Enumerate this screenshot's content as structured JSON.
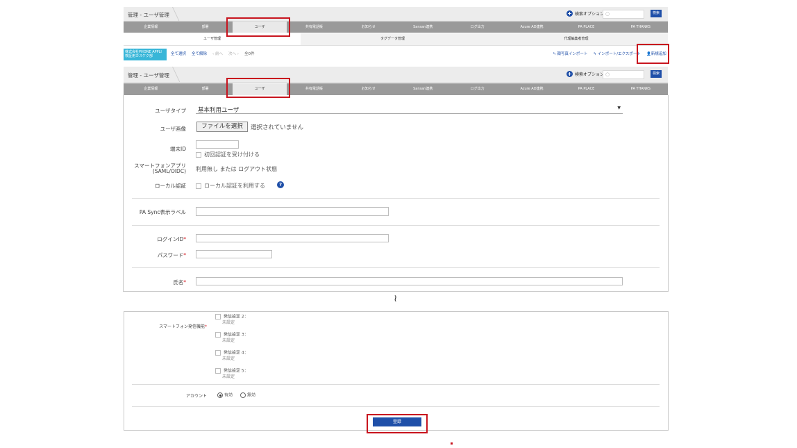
{
  "header": {
    "breadcrumb": "管理 - ユーザ管理",
    "search_option": "検索オプション",
    "search_button": "検索"
  },
  "nav": {
    "tabs": [
      "企業情報",
      "部署",
      "ユーザ",
      "共有電話帳",
      "お知らせ",
      "Sansan連携",
      "ログ出力",
      "Azure AD連携",
      "PA PLACE",
      "PA THANKS"
    ]
  },
  "subnav": {
    "tabs": [
      "ユーザ管理",
      "タグデータ管理",
      "代理編集者管理"
    ]
  },
  "toolbar": {
    "company": "株式会社PHONE APPLI 検証用カスケク部",
    "select_all": "全て選択",
    "deselect_all": "全て解除",
    "prev": "前へ",
    "next": "次へ",
    "page_info": "全0件",
    "import_bulk": "顔写真インポート",
    "import_export": "インポート/エクスポート",
    "add_new": "新規追加"
  },
  "form": {
    "user_type_label": "ユーザタイプ",
    "user_type_value": "基本利用ユーザ",
    "user_image_label": "ユーザ画像",
    "file_button": "ファイルを選択",
    "file_status": "選択されていません",
    "terminal_id_label": "端末ID",
    "first_auth_label": "初回認証を受け付ける",
    "smartphone_app_label_1": "スマートフォンアプリ",
    "smartphone_app_label_2": "(SAML/OIDC)",
    "smartphone_app_value": "利用無し または ログアウト状態",
    "local_auth_label": "ローカル認証",
    "local_auth_check": "ローカル認証を利用する",
    "help_icon": "?",
    "pa_sync_label": "PA Sync表示ラベル",
    "login_id_label": "ログインID",
    "password_label": "パスワード",
    "name_label": "氏名",
    "required_mark": "*"
  },
  "break_mark": "≀",
  "form2": {
    "smartphone_call_label": "スマートフォン発信機能",
    "required_mark": "*",
    "call_settings": [
      {
        "label": "発信設定 2：",
        "value": "未設定"
      },
      {
        "label": "発信設定 3：",
        "value": "未設定"
      },
      {
        "label": "発信設定 4：",
        "value": "未設定"
      },
      {
        "label": "発信設定 5：",
        "value": "未設定"
      }
    ],
    "account_label": "アカウント",
    "account_enabled": "有効",
    "account_disabled": "無効",
    "register_button": "登録"
  },
  "colors": {
    "accent": "#1f4fa8",
    "highlight": "#c8141e",
    "nav_bg": "#9a9a9a",
    "company_bg": "#38b6d8"
  }
}
